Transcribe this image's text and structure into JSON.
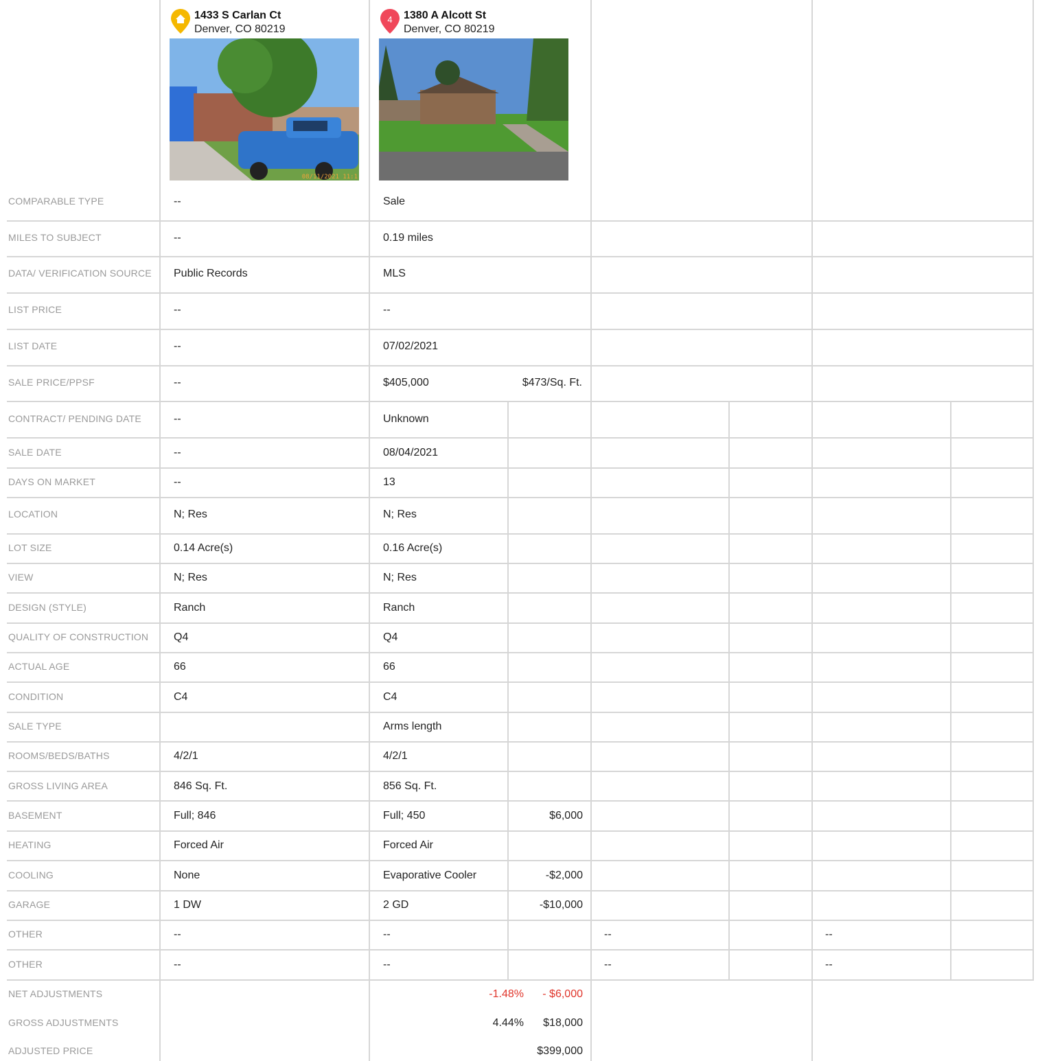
{
  "subject": {
    "address_line1": "1433 S Carlan Ct",
    "address_line2": "Denver, CO 80219",
    "marker_icon": "home-icon",
    "marker_color": "#f5b800"
  },
  "comp1": {
    "address_line1": "1380 A Alcott St",
    "address_line2": "Denver, CO 80219",
    "marker_number": "4",
    "marker_color": "#f0475a"
  },
  "photo_caption": "08/11/2021 11:1",
  "rows": [
    {
      "label": "COMPARABLE TYPE",
      "subject": "--",
      "comp": "Sale",
      "adj": ""
    },
    {
      "label": "MILES TO SUBJECT",
      "subject": "--",
      "comp": "0.19 miles",
      "adj": ""
    },
    {
      "label": "DATA/ VERIFICATION SOURCE",
      "subject": "Public Records",
      "comp": "MLS",
      "adj": ""
    },
    {
      "label": "LIST PRICE",
      "subject": "--",
      "comp": "--",
      "adj": ""
    },
    {
      "label": "LIST DATE",
      "subject": "--",
      "comp": "07/02/2021",
      "adj": ""
    },
    {
      "label": "SALE PRICE/PPSF",
      "subject": "--",
      "comp": "$405,000",
      "adj": "$473/Sq. Ft."
    },
    {
      "label": "CONTRACT/ PENDING DATE",
      "subject": "--",
      "comp": "Unknown",
      "adj": ""
    },
    {
      "label": "SALE DATE",
      "subject": "--",
      "comp": "08/04/2021",
      "adj": ""
    },
    {
      "label": "DAYS ON MARKET",
      "subject": "--",
      "comp": "13",
      "adj": ""
    },
    {
      "label": "LOCATION",
      "subject": "N; Res",
      "comp": "N; Res",
      "adj": ""
    },
    {
      "label": "LOT SIZE",
      "subject": "0.14 Acre(s)",
      "comp": "0.16 Acre(s)",
      "adj": ""
    },
    {
      "label": "VIEW",
      "subject": "N; Res",
      "comp": "N; Res",
      "adj": ""
    },
    {
      "label": "DESIGN (STYLE)",
      "subject": "Ranch",
      "comp": "Ranch",
      "adj": ""
    },
    {
      "label": "QUALITY OF CONSTRUCTION",
      "subject": "Q4",
      "comp": "Q4",
      "adj": ""
    },
    {
      "label": "ACTUAL AGE",
      "subject": "66",
      "comp": "66",
      "adj": ""
    },
    {
      "label": "CONDITION",
      "subject": "C4",
      "comp": "C4",
      "adj": ""
    },
    {
      "label": "SALE TYPE",
      "subject": "",
      "comp": "Arms length",
      "adj": ""
    },
    {
      "label": "ROOMS/BEDS/BATHS",
      "subject": "4/2/1",
      "comp": "4/2/1",
      "adj": ""
    },
    {
      "label": "GROSS LIVING AREA",
      "subject": "846 Sq. Ft.",
      "comp": "856 Sq. Ft.",
      "adj": ""
    },
    {
      "label": "BASEMENT",
      "subject": "Full; 846",
      "comp": "Full; 450",
      "adj": "$6,000"
    },
    {
      "label": "HEATING",
      "subject": "Forced Air",
      "comp": "Forced Air",
      "adj": ""
    },
    {
      "label": "COOLING",
      "subject": "None",
      "comp": "Evaporative Cooler",
      "adj": "-$2,000"
    },
    {
      "label": "GARAGE",
      "subject": "1 DW",
      "comp": "2 GD",
      "adj": "-$10,000"
    },
    {
      "label": "OTHER",
      "subject": "--",
      "comp": "--",
      "adj": "",
      "comp2": "--",
      "comp3": "--"
    },
    {
      "label": "OTHER",
      "subject": "--",
      "comp": "--",
      "adj": "",
      "comp2": "--",
      "comp3": "--"
    }
  ],
  "summary": {
    "net_label": "NET ADJUSTMENTS",
    "net_pct": "-1.48%",
    "net_amt": "- $6,000",
    "gross_label": "GROSS ADJUSTMENTS",
    "gross_pct": "4.44%",
    "gross_amt": "$18,000",
    "adjusted_label": "ADJUSTED PRICE",
    "adjusted_amt": "$399,000"
  }
}
